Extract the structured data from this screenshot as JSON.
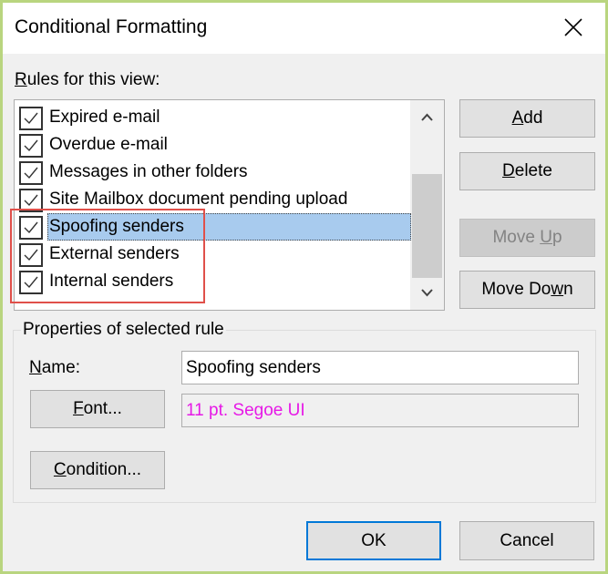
{
  "window": {
    "title": "Conditional Formatting",
    "close_icon": "close-icon"
  },
  "rules": {
    "label_prefix": "R",
    "label_rest": "ules for this view:",
    "items": [
      {
        "label": "Expired e-mail",
        "checked": true,
        "selected": false
      },
      {
        "label": "Overdue e-mail",
        "checked": true,
        "selected": false
      },
      {
        "label": "Messages in other folders",
        "checked": true,
        "selected": false
      },
      {
        "label": "Site Mailbox document pending upload",
        "checked": true,
        "selected": false
      },
      {
        "label": "Spoofing senders",
        "checked": true,
        "selected": true
      },
      {
        "label": "External senders",
        "checked": true,
        "selected": false
      },
      {
        "label": "Internal senders",
        "checked": true,
        "selected": false
      }
    ],
    "highlight_color": "#e0504a",
    "selection_color": "#a8cbee"
  },
  "buttons": {
    "add": {
      "accel": "A",
      "rest": "dd"
    },
    "delete": {
      "accel": "D",
      "rest": "elete"
    },
    "move_up": {
      "before": "Move ",
      "accel": "U",
      "rest": "p",
      "disabled": true
    },
    "move_down": {
      "before": "Move Do",
      "accel": "w",
      "rest": "n"
    },
    "ok": "OK",
    "cancel": "Cancel"
  },
  "properties": {
    "group_label": "Properties of selected rule",
    "name_label_accel": "N",
    "name_label_rest": "ame:",
    "name_value": "Spoofing senders",
    "font_button": {
      "accel": "F",
      "rest": "ont..."
    },
    "font_value": "11 pt. Segoe UI",
    "font_value_color": "#e619e6",
    "condition_button": {
      "accel": "C",
      "rest": "ondition..."
    }
  }
}
